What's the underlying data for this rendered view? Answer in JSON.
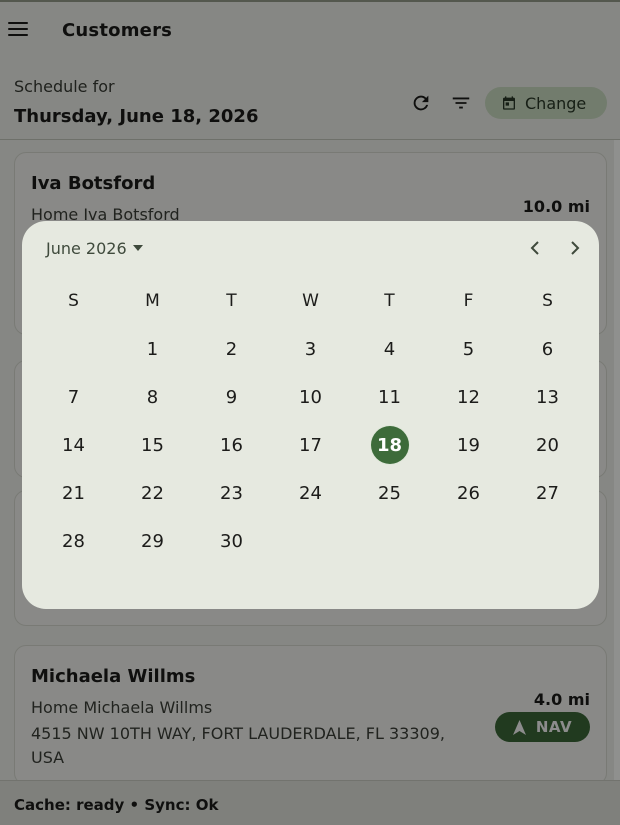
{
  "appbar": {
    "title": "Customers"
  },
  "schedule": {
    "label": "Schedule for",
    "date": "Thursday, June 18, 2026",
    "change_label": "Change"
  },
  "customers": [
    {
      "name": "Iva Botsford",
      "subtitle": "Home Iva Botsford",
      "distance": "10.0 mi"
    },
    {
      "name": "Michaela Willms",
      "subtitle": "Home Michaela Willms",
      "address": "4515 NW 10TH WAY, FORT LAUDERDALE, FL 33309, USA",
      "distance": "4.0 mi",
      "nav_label": "NAV"
    }
  ],
  "status": {
    "text": "Cache: ready • Sync: Ok"
  },
  "picker": {
    "month_label": "June 2026",
    "weekdays": [
      "S",
      "M",
      "T",
      "W",
      "T",
      "F",
      "S"
    ],
    "weeks": [
      [
        "",
        "1",
        "2",
        "3",
        "4",
        "5",
        "6"
      ],
      [
        "7",
        "8",
        "9",
        "10",
        "11",
        "12",
        "13"
      ],
      [
        "14",
        "15",
        "16",
        "17",
        "18",
        "19",
        "20"
      ],
      [
        "21",
        "22",
        "23",
        "24",
        "25",
        "26",
        "27"
      ],
      [
        "28",
        "29",
        "30",
        "",
        "",
        "",
        ""
      ]
    ],
    "selected_day": "18"
  },
  "colors": {
    "accent": "#3d6b3a",
    "tonal_button": "#cfe2c6",
    "picker_surface": "#e6e9e0",
    "scrim": "rgba(0,0,0,0.45)"
  },
  "icons": [
    "menu-icon",
    "refresh-icon",
    "sort-icon",
    "calendar-icon",
    "navigation-arrow-icon",
    "dropdown-arrow-icon",
    "chevron-left-icon",
    "chevron-right-icon"
  ]
}
